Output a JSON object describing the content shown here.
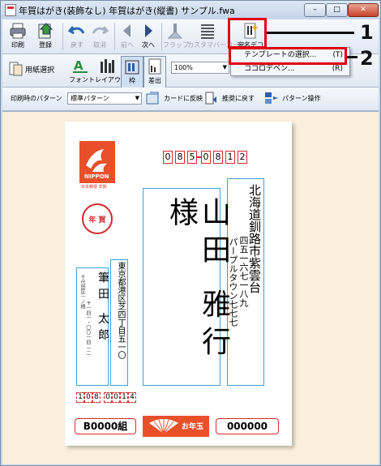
{
  "window": {
    "title": "年賀はがき(装飾なし) 年賀はがき(縦書) サンプル.fwa",
    "min": "–",
    "max": "□",
    "close": "✕"
  },
  "toolbar1": {
    "print": "印刷",
    "register": "登録",
    "undo": "戻す",
    "cancel": "取消",
    "prev": "前へ",
    "next": "次へ",
    "flap": "フラップ",
    "custom_barcode": "カスタマバーコード",
    "address_design": "宛名デコ"
  },
  "toolbar2": {
    "paper_select": "用紙選択",
    "font": "フォント",
    "layout": "レイアウト",
    "frame": "枠",
    "sender": "差出",
    "zoom": "100%"
  },
  "toolbar3": {
    "print_pattern_label": "印刷時のパターン",
    "print_pattern_value": "標準パターン",
    "reflect_card": "カードに反映",
    "restore": "推奨に戻す",
    "pattern_ops": "パターン操作"
  },
  "menu": {
    "items": [
      {
        "label": "テンプレートの選択...",
        "key": "(T)"
      },
      {
        "label": "ココロデベン...",
        "key": "(R)"
      }
    ]
  },
  "callouts": {
    "one": "1",
    "two": "2"
  },
  "postcard": {
    "stamp_caption": "NIPPON",
    "stamp_sub": "日本郵便 年賀",
    "postmark": "年 賀",
    "zip_digits": [
      "0",
      "8",
      "5",
      "0",
      "8",
      "1",
      "2"
    ],
    "recipient_address_1": "北海道釧路市紫雲台",
    "recipient_address_2": "四五一六七一八九",
    "recipient_address_3": "パープルタウン七七七",
    "recipient_name": "山田 雅行 様",
    "sender_address": "東京都港区芝四丁目五一〇",
    "sender_address_2": "千代田区一ノ橋",
    "sender_address_3": "〒一四一・〇〇一四 一二",
    "sender_name": "筆田 太郎",
    "sender_zip": [
      "1",
      "0",
      "8",
      "0",
      "0",
      "1",
      "4"
    ],
    "lottery_left": "B0000組",
    "otoshidama": "お年玉",
    "lottery_right": "000000"
  }
}
